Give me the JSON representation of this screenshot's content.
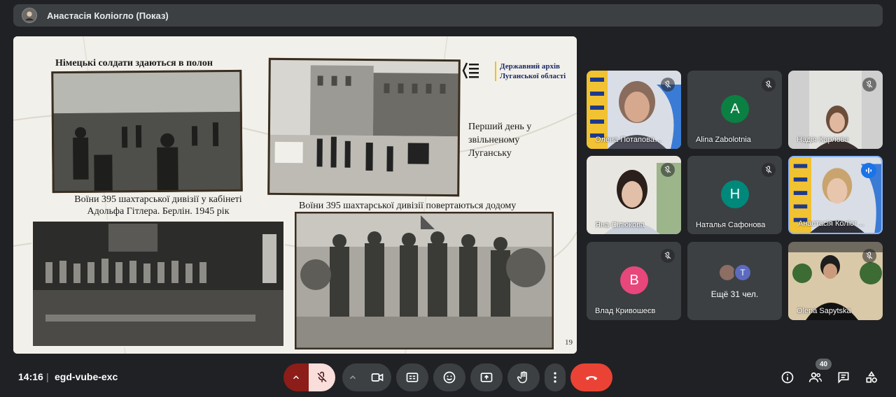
{
  "header": {
    "presenter_title": "Анастасія Коліогло (Показ)"
  },
  "slide": {
    "caption_1": "Німецькі солдати здаються в полон",
    "caption_2_line1": "Воїни 395 шахтарської дивізії у кабінеті",
    "caption_2_line2": "Адольфа Гітлера. Берлін. 1945 рік",
    "caption_3_line1": "Перший день у",
    "caption_3_line2": "звільненому",
    "caption_3_line3": "Луганську",
    "caption_4": "Воїни 395 шахтарської дивізії повертаються додому",
    "archive_line1": "Державний архів",
    "archive_line2": "Луганської області",
    "page_number": "19"
  },
  "participants": [
    {
      "name": "Олена Потапова…",
      "type": "video",
      "muted": true
    },
    {
      "name": "Alina Zabolotnia",
      "type": "letter",
      "letter": "A",
      "color": "#0b8043",
      "muted": true
    },
    {
      "name": "Надія Карлова",
      "type": "video",
      "muted": true
    },
    {
      "name": "Яна Сілюкова",
      "type": "video",
      "muted": true
    },
    {
      "name": "Наталья Сафонова",
      "type": "letter",
      "letter": "Н",
      "color": "#00897b",
      "muted": true
    },
    {
      "name": "Анастасія Коліог…",
      "type": "video",
      "muted": false,
      "speaking": true
    },
    {
      "name": "Влад Кривошеєв",
      "type": "letter",
      "letter": "В",
      "color": "#e8477b",
      "muted": true
    },
    {
      "name": "Ещё 31 чел.",
      "type": "more",
      "letter": "T"
    },
    {
      "name": "Olena Sapytska",
      "type": "video",
      "muted": true
    }
  ],
  "bottombar": {
    "clock": "14:16",
    "separator": "|",
    "meeting_code": "egd-vube-exc",
    "participant_count": "40"
  },
  "colors": {
    "end_call": "#ea4335",
    "mic_off_bg": "#f9dedc",
    "mic_chevron_bg": "#8c1d18",
    "speaking": "#1a73e8"
  }
}
